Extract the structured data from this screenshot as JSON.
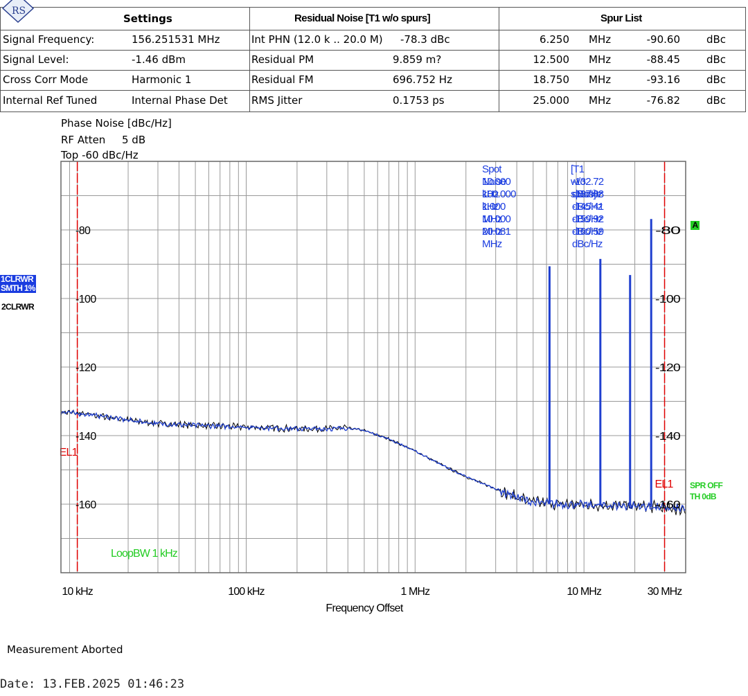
{
  "logo_text": "RS",
  "header": {
    "settings_title": "Settings",
    "residual_title": "Residual Noise [T1 w/o spurs]",
    "spur_title": "Spur List",
    "settings": [
      {
        "label": "Signal Frequency:",
        "value": "156.251531 MHz"
      },
      {
        "label": "Signal Level:",
        "value": "-1.46 dBm"
      },
      {
        "label": "Cross Corr Mode",
        "value": "Harmonic 1"
      },
      {
        "label": "Internal Ref Tuned",
        "value": "Internal Phase Det"
      }
    ],
    "residual": [
      {
        "label": "Int PHN (12.0 k .. 20.0 M)",
        "value": "-78.3 dBc"
      },
      {
        "label": "Residual PM",
        "value": "9.859 m?"
      },
      {
        "label": "Residual FM",
        "value": "696.752 Hz"
      },
      {
        "label": "RMS Jitter",
        "value": "0.1753 ps"
      }
    ],
    "spurs": [
      {
        "freq": "6.250",
        "unit": "MHz",
        "level": "-90.60",
        "lunit": "dBc"
      },
      {
        "freq": "12.500",
        "unit": "MHz",
        "level": "-88.45",
        "lunit": "dBc"
      },
      {
        "freq": "18.750",
        "unit": "MHz",
        "level": "-93.16",
        "lunit": "dBc"
      },
      {
        "freq": "25.000",
        "unit": "MHz",
        "level": "-76.82",
        "lunit": "dBc"
      }
    ]
  },
  "plot_info": {
    "ylabel": "Phase Noise [dBc/Hz]",
    "rf_atten_label": "RF Atten",
    "rf_atten_value": "5 dB",
    "top_label": "Top -60 dBc/Hz"
  },
  "spot_noise": {
    "header_left": "Spot Noise",
    "header_right": "[T1 w/o spurs]",
    "rows": [
      {
        "freq": "10.000 kHz",
        "level": "-132.72 dBc/Hz"
      },
      {
        "freq": "100.000 kHz",
        "level": "-137.08 dBc/Hz"
      },
      {
        "freq": "1.000 MHz",
        "level": "-145.41 dBc/Hz"
      },
      {
        "freq": "10.000 MHz",
        "level": "-159.92 dBc/Hz"
      },
      {
        "freq": "20.081 MHz",
        "level": "-160.59 dBc/Hz"
      }
    ]
  },
  "side_labels": {
    "trace1_line1": "1CLRWR",
    "trace1_line2": "SMTH 1%",
    "trace2": "2CLRWR",
    "marker_a": "A",
    "spr_off": "SPR OFF",
    "th": "TH 0dB",
    "loop_bw": "LoopBW 1 kHz"
  },
  "colors": {
    "trace_blue": "#1f3fcf",
    "trace_black": "#000000",
    "limit_red": "#e00000",
    "annotation_blue": "#1a3ce0",
    "green": "#22cc22",
    "grid": "#999999"
  },
  "chart_data": {
    "type": "line",
    "xlabel": "Frequency Offset",
    "ylabel": "Phase Noise [dBc/Hz]",
    "x_scale": "log",
    "xlim_hz": [
      8000,
      40000000
    ],
    "ylim": [
      -180,
      -60
    ],
    "x_tick_labels": [
      "10 kHz",
      "100 kHz",
      "1 MHz",
      "10 MHz",
      "30 MHz"
    ],
    "x_tick_values_hz": [
      10000,
      100000,
      1000000,
      10000000,
      30000000
    ],
    "y_tick_labels": [
      "-80",
      "-100",
      "-120",
      "-140",
      "-160"
    ],
    "y_tick_values": [
      -80,
      -100,
      -120,
      -140,
      -160
    ],
    "series": [
      {
        "x_hz": [
          8000,
          10000,
          15000,
          20000,
          30000,
          50000,
          100000,
          200000,
          300000,
          400000,
          500000,
          700000,
          1000000,
          1500000,
          2000000,
          3000000,
          4000000,
          5000000,
          7000000,
          10000000,
          20000000,
          40000000
        ],
        "y": [
          -133.2,
          -133.5,
          -134.5,
          -135.5,
          -136.5,
          -137,
          -137.5,
          -138,
          -138,
          -137.8,
          -138.5,
          -141,
          -144.5,
          -149,
          -152,
          -155.5,
          -158,
          -159.5,
          -160,
          -160.2,
          -160.5,
          -161.5
        ]
      }
    ],
    "spurs": [
      {
        "x_hz": 6250000,
        "y": -90.6
      },
      {
        "x_hz": 12500000,
        "y": -88.45
      },
      {
        "x_hz": 18750000,
        "y": -93.16
      },
      {
        "x_hz": 25000000,
        "y": -76.82
      }
    ],
    "limit_lines": [
      {
        "label": "EL1",
        "x_hz": 10000
      },
      {
        "label": "EL1",
        "x_hz": 30000000
      }
    ],
    "grid": true
  },
  "footer": {
    "status": "Measurement Aborted",
    "date": "Date: 13.FEB.2025  01:46:23"
  }
}
